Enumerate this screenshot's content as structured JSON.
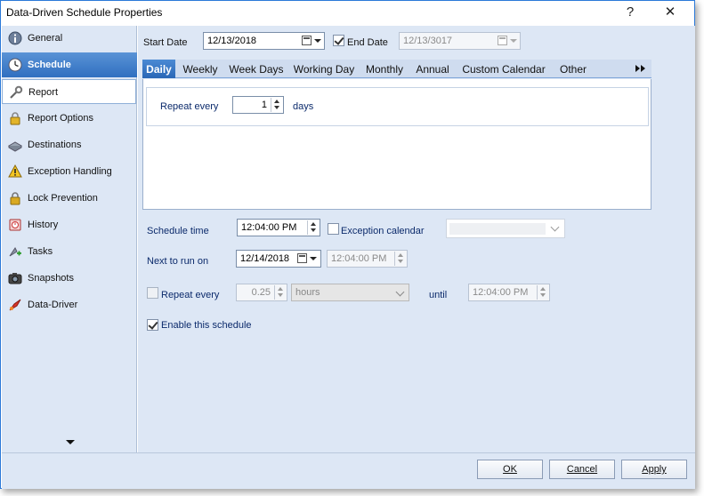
{
  "window": {
    "title": "Data-Driven Schedule Properties",
    "help_label": "?",
    "close_label": "✕"
  },
  "sidebar": {
    "items": [
      {
        "label": "General",
        "icon": "info-icon"
      },
      {
        "label": "Schedule",
        "icon": "clock-icon",
        "active": true
      },
      {
        "label": "Report",
        "icon": "wrench-icon"
      },
      {
        "label": "Report Options",
        "icon": "lock-icon"
      },
      {
        "label": "Destinations",
        "icon": "hard-drive-icon"
      },
      {
        "label": "Exception Handling",
        "icon": "warning-icon"
      },
      {
        "label": "Lock Prevention",
        "icon": "padlock-icon"
      },
      {
        "label": "History",
        "icon": "history-icon"
      },
      {
        "label": "Tasks",
        "icon": "tasks-icon"
      },
      {
        "label": "Snapshots",
        "icon": "camera-icon"
      },
      {
        "label": "Data-Driver",
        "icon": "data-driver-icon"
      }
    ]
  },
  "schedule": {
    "start_date_label": "Start Date",
    "start_date": "12/13/2018",
    "end_date_label": "End Date",
    "end_date_checked": true,
    "end_date": "12/13/3017",
    "tabs": [
      "Daily",
      "Weekly",
      "Week Days",
      "Working Day",
      "Monthly",
      "Annual",
      "Custom Calendar",
      "Other"
    ],
    "active_tab": "Daily",
    "repeat_every_label": "Repeat every",
    "repeat_every_value": "1",
    "repeat_every_unit": "days",
    "schedule_time_label": "Schedule time",
    "schedule_time": "12:04:00 PM",
    "exception_calendar_label": "Exception calendar",
    "exception_calendar_checked": false,
    "next_to_run_label": "Next to run on",
    "next_run_date": "12/14/2018",
    "next_run_time": "12:04:00 PM",
    "repeat_label": "Repeat every",
    "repeat_checked": false,
    "repeat_value": "0.25",
    "repeat_unit": "hours",
    "until_label": "until",
    "until_time": "12:04:00 PM",
    "enable_label": "Enable this schedule",
    "enable_checked": true
  },
  "footer": {
    "ok_label": "OK",
    "cancel_label": "Cancel",
    "apply_label": "Apply"
  },
  "colors": {
    "accent": "#2f6fc0",
    "panel_bg": "#dde7f5",
    "label_blue": "#0b2a6b"
  }
}
